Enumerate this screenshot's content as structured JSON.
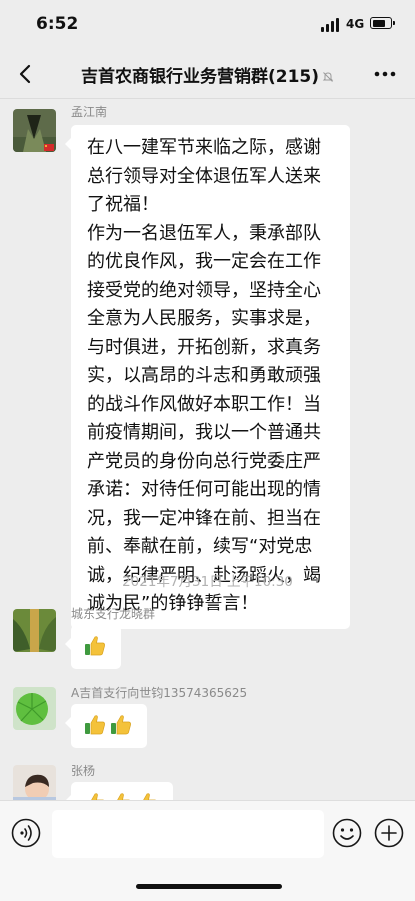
{
  "status_bar": {
    "time": "6:52",
    "network": "4G"
  },
  "header": {
    "title": "吉首农商银行业务营销群(215)"
  },
  "messages": [
    {
      "sender": "孟江南",
      "text": "在八一建军节来临之际，感谢\n总行领导对全体退伍军人送来\n了祝福！\n作为一名退伍军人，秉承部队\n的优良作风，我一定会在工作\n接受党的绝对领导，坚持全心\n全意为人民服务，实事求是，\n与时俱进，开拓创新，求真务\n实，以高昂的斗志和勇敢顽强\n的战斗作风做好本职工作！当\n前疫情期间，我以一个普通共\n产党员的身份向总行党委庄严\n承诺：对待任何可能出现的情\n况，我一定冲锋在前、担当在\n前、奉献在前，续写“对党忠\n诚，纪律严明、赴汤蹈火，竭\n诚为民”的铮铮誓言！"
    },
    {
      "sender": "城东支行龙晓群",
      "thumbs": 1
    },
    {
      "sender": "A吉首支行向世钧13574365625",
      "thumbs": 2
    },
    {
      "sender": "张杨",
      "thumbs": 3
    }
  ],
  "timestamp": "2021年7月31日 上午10:30",
  "colors": {
    "background": "#ededed",
    "bubble": "#ffffff",
    "thumb": "#f4c23a",
    "thumb_cuff": "#3f9a3f"
  },
  "icons": [
    "back-arrow-icon",
    "mute-bell-icon",
    "more-dots-icon",
    "voice-icon",
    "emoji-icon",
    "plus-icon",
    "thumbs-up-icon"
  ]
}
